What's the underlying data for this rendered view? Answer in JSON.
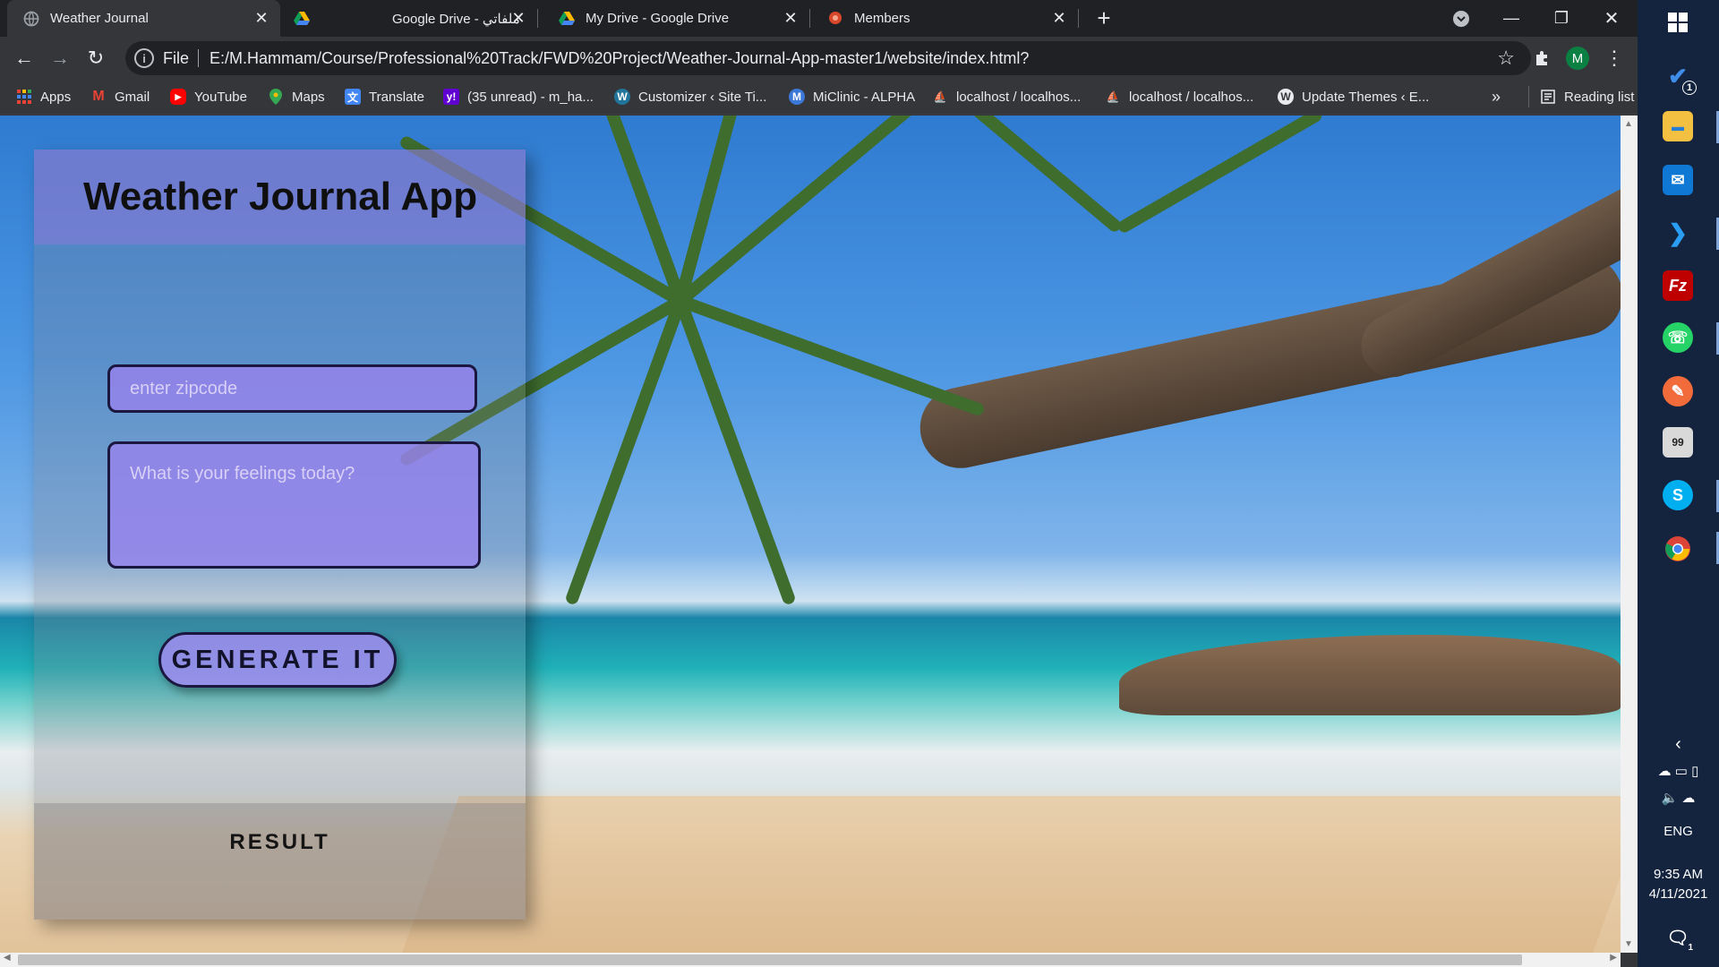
{
  "browser": {
    "tabs": [
      {
        "title": "Weather Journal",
        "active": true
      },
      {
        "title": "Google Drive - ملفاتي",
        "active": false
      },
      {
        "title": "My Drive - Google Drive",
        "active": false
      },
      {
        "title": "Members",
        "active": false
      }
    ],
    "address": {
      "scheme": "File",
      "url": "E:/M.Hammam/Course/Professional%20Track/FWD%20Project/Weather-Journal-App-master1/website/index.html?"
    },
    "profile_initial": "M",
    "bookmarks": [
      {
        "label": "Apps",
        "icon": "apps-grid-icon"
      },
      {
        "label": "Gmail",
        "icon": "gmail-icon"
      },
      {
        "label": "YouTube",
        "icon": "youtube-icon"
      },
      {
        "label": "Maps",
        "icon": "maps-icon"
      },
      {
        "label": "Translate",
        "icon": "translate-icon"
      },
      {
        "label": "(35 unread) - m_ha...",
        "icon": "yahoo-icon"
      },
      {
        "label": "Customizer ‹ Site Ti...",
        "icon": "wordpress-icon"
      },
      {
        "label": "MiClinic - ALPHA",
        "icon": "miclinic-icon"
      },
      {
        "label": "localhost / localhos...",
        "icon": "phpmyadmin-icon"
      },
      {
        "label": "localhost / localhos...",
        "icon": "phpmyadmin-icon"
      },
      {
        "label": "Update Themes ‹ E...",
        "icon": "wordpress-icon"
      }
    ],
    "more_bookmarks": "»",
    "reading_list": "Reading list"
  },
  "app": {
    "title": "Weather Journal App",
    "zip_placeholder": "enter zipcode",
    "zip_value": "",
    "feelings_placeholder": "What is your feelings today?",
    "feelings_value": "",
    "generate_label": "GENERATE IT",
    "result_label": "RESULT"
  },
  "taskbar": {
    "language": "ENG",
    "time": "9:35 AM",
    "date": "4/11/2021",
    "todo_badge": "1",
    "notification_badge": "1"
  },
  "colors": {
    "chrome_dark": "#202124",
    "chrome_toolbar": "#35363a",
    "panel_purple": "#9682eb",
    "taskbar": "#14243f"
  }
}
